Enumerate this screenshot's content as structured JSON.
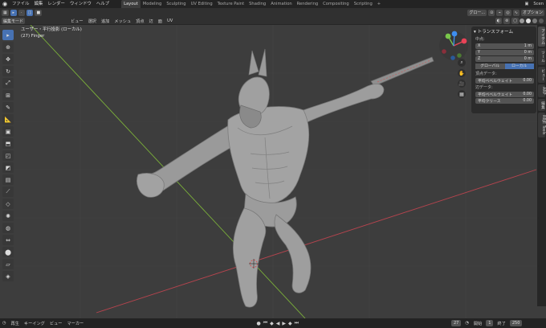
{
  "app": {
    "menu": [
      "ファイル",
      "編集",
      "レンダー",
      "ウィンドウ",
      "ヘルプ"
    ],
    "workspaces": [
      {
        "label": "Layout",
        "active": true
      },
      {
        "label": "Modeling",
        "active": false
      },
      {
        "label": "Sculpting",
        "active": false
      },
      {
        "label": "UV Editing",
        "active": false
      },
      {
        "label": "Texture Paint",
        "active": false
      },
      {
        "label": "Shading",
        "active": false
      },
      {
        "label": "Animation",
        "active": false
      },
      {
        "label": "Rendering",
        "active": false
      },
      {
        "label": "Compositing",
        "active": false
      },
      {
        "label": "Scripting",
        "active": false
      }
    ],
    "add_workspace": "+",
    "scene_label": "Scen"
  },
  "header": {
    "global_label": "グロー...",
    "options_label": "オプション",
    "mode_label": "編集モード",
    "menus": [
      "ビュー",
      "選択",
      "追加",
      "メッシュ",
      "頂点",
      "辺",
      "面",
      "UV"
    ]
  },
  "viewport": {
    "view_name": "ユーザー・平行投影 (ローカル)",
    "object_name": "(27) Finger"
  },
  "npanel": {
    "title": "トランスフォーム",
    "median_label": "中点:",
    "fields": [
      {
        "axis": "X",
        "value": "1 m"
      },
      {
        "axis": "Y",
        "value": "0 m"
      },
      {
        "axis": "Z",
        "value": "0 m"
      }
    ],
    "global_btn": "グローバル",
    "local_btn": "ローカル",
    "vertex_data_label": "頂点データ:",
    "vertex_bevel": {
      "label": "平均ベベルウェイト",
      "value": "0.00"
    },
    "edge_data_label": "辺データ:",
    "edge_bevel": {
      "label": "平均ベベルウェイト",
      "value": "0.00"
    },
    "edge_crease": {
      "label": "平均クリース",
      "value": "0.00"
    }
  },
  "sidetabs": [
    {
      "label": "アイテム",
      "active": true
    },
    {
      "label": "ツール",
      "active": false
    },
    {
      "label": "ビュー",
      "active": false
    },
    {
      "label": "ARP",
      "active": false
    },
    {
      "label": "編集",
      "active": false
    },
    {
      "label": "RBJE Tools",
      "active": false
    }
  ],
  "timeline": {
    "playback": "再生",
    "keying": "キーイング",
    "view": "ビュー",
    "marker": "マーカー",
    "current_frame": "27",
    "start_label": "開始",
    "start_value": "1",
    "end_label": "終了",
    "end_value": "250"
  },
  "colors": {
    "accent": "#4772b3",
    "x_axis": "#b5444e",
    "y_axis": "#7bb03a",
    "gizmo_x": "#e84357",
    "gizmo_y": "#7ac74b",
    "gizmo_z": "#3e8ef0"
  }
}
